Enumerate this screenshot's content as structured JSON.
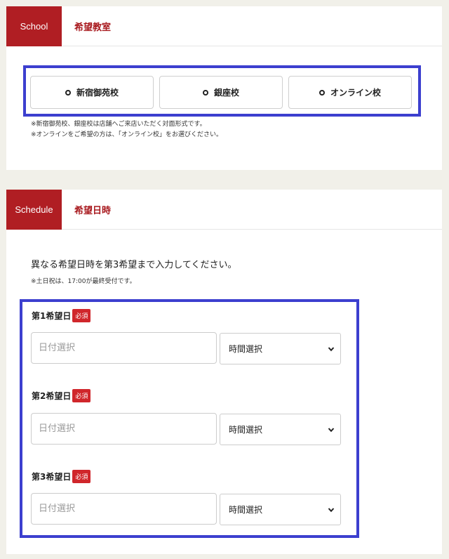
{
  "school": {
    "tag": "School",
    "title": "希望教室",
    "options": [
      {
        "label": "新宿御苑校"
      },
      {
        "label": "銀座校"
      },
      {
        "label": "オンライン校"
      }
    ],
    "notes": [
      "※新宿御苑校、銀座校は店舗へご来店いただく対面形式です。",
      "※オンラインをご希望の方は、「オンライン校」をお選びください。"
    ]
  },
  "schedule": {
    "tag": "Schedule",
    "title": "希望日時",
    "intro": "異なる希望日時を第3希望まで入力してください。",
    "note": "※土日祝は、17:00が最終受付です。",
    "required_badge": "必須",
    "preferences": [
      {
        "label": "第1希望日",
        "date_placeholder": "日付選択",
        "time_selected": "時間選択"
      },
      {
        "label": "第2希望日",
        "date_placeholder": "日付選択",
        "time_selected": "時間選択"
      },
      {
        "label": "第3希望日",
        "date_placeholder": "日付選択",
        "time_selected": "時間選択"
      }
    ]
  },
  "colors": {
    "brand": "#b01e23",
    "highlight": "#3c3fcf",
    "background": "#f1f0e9"
  }
}
